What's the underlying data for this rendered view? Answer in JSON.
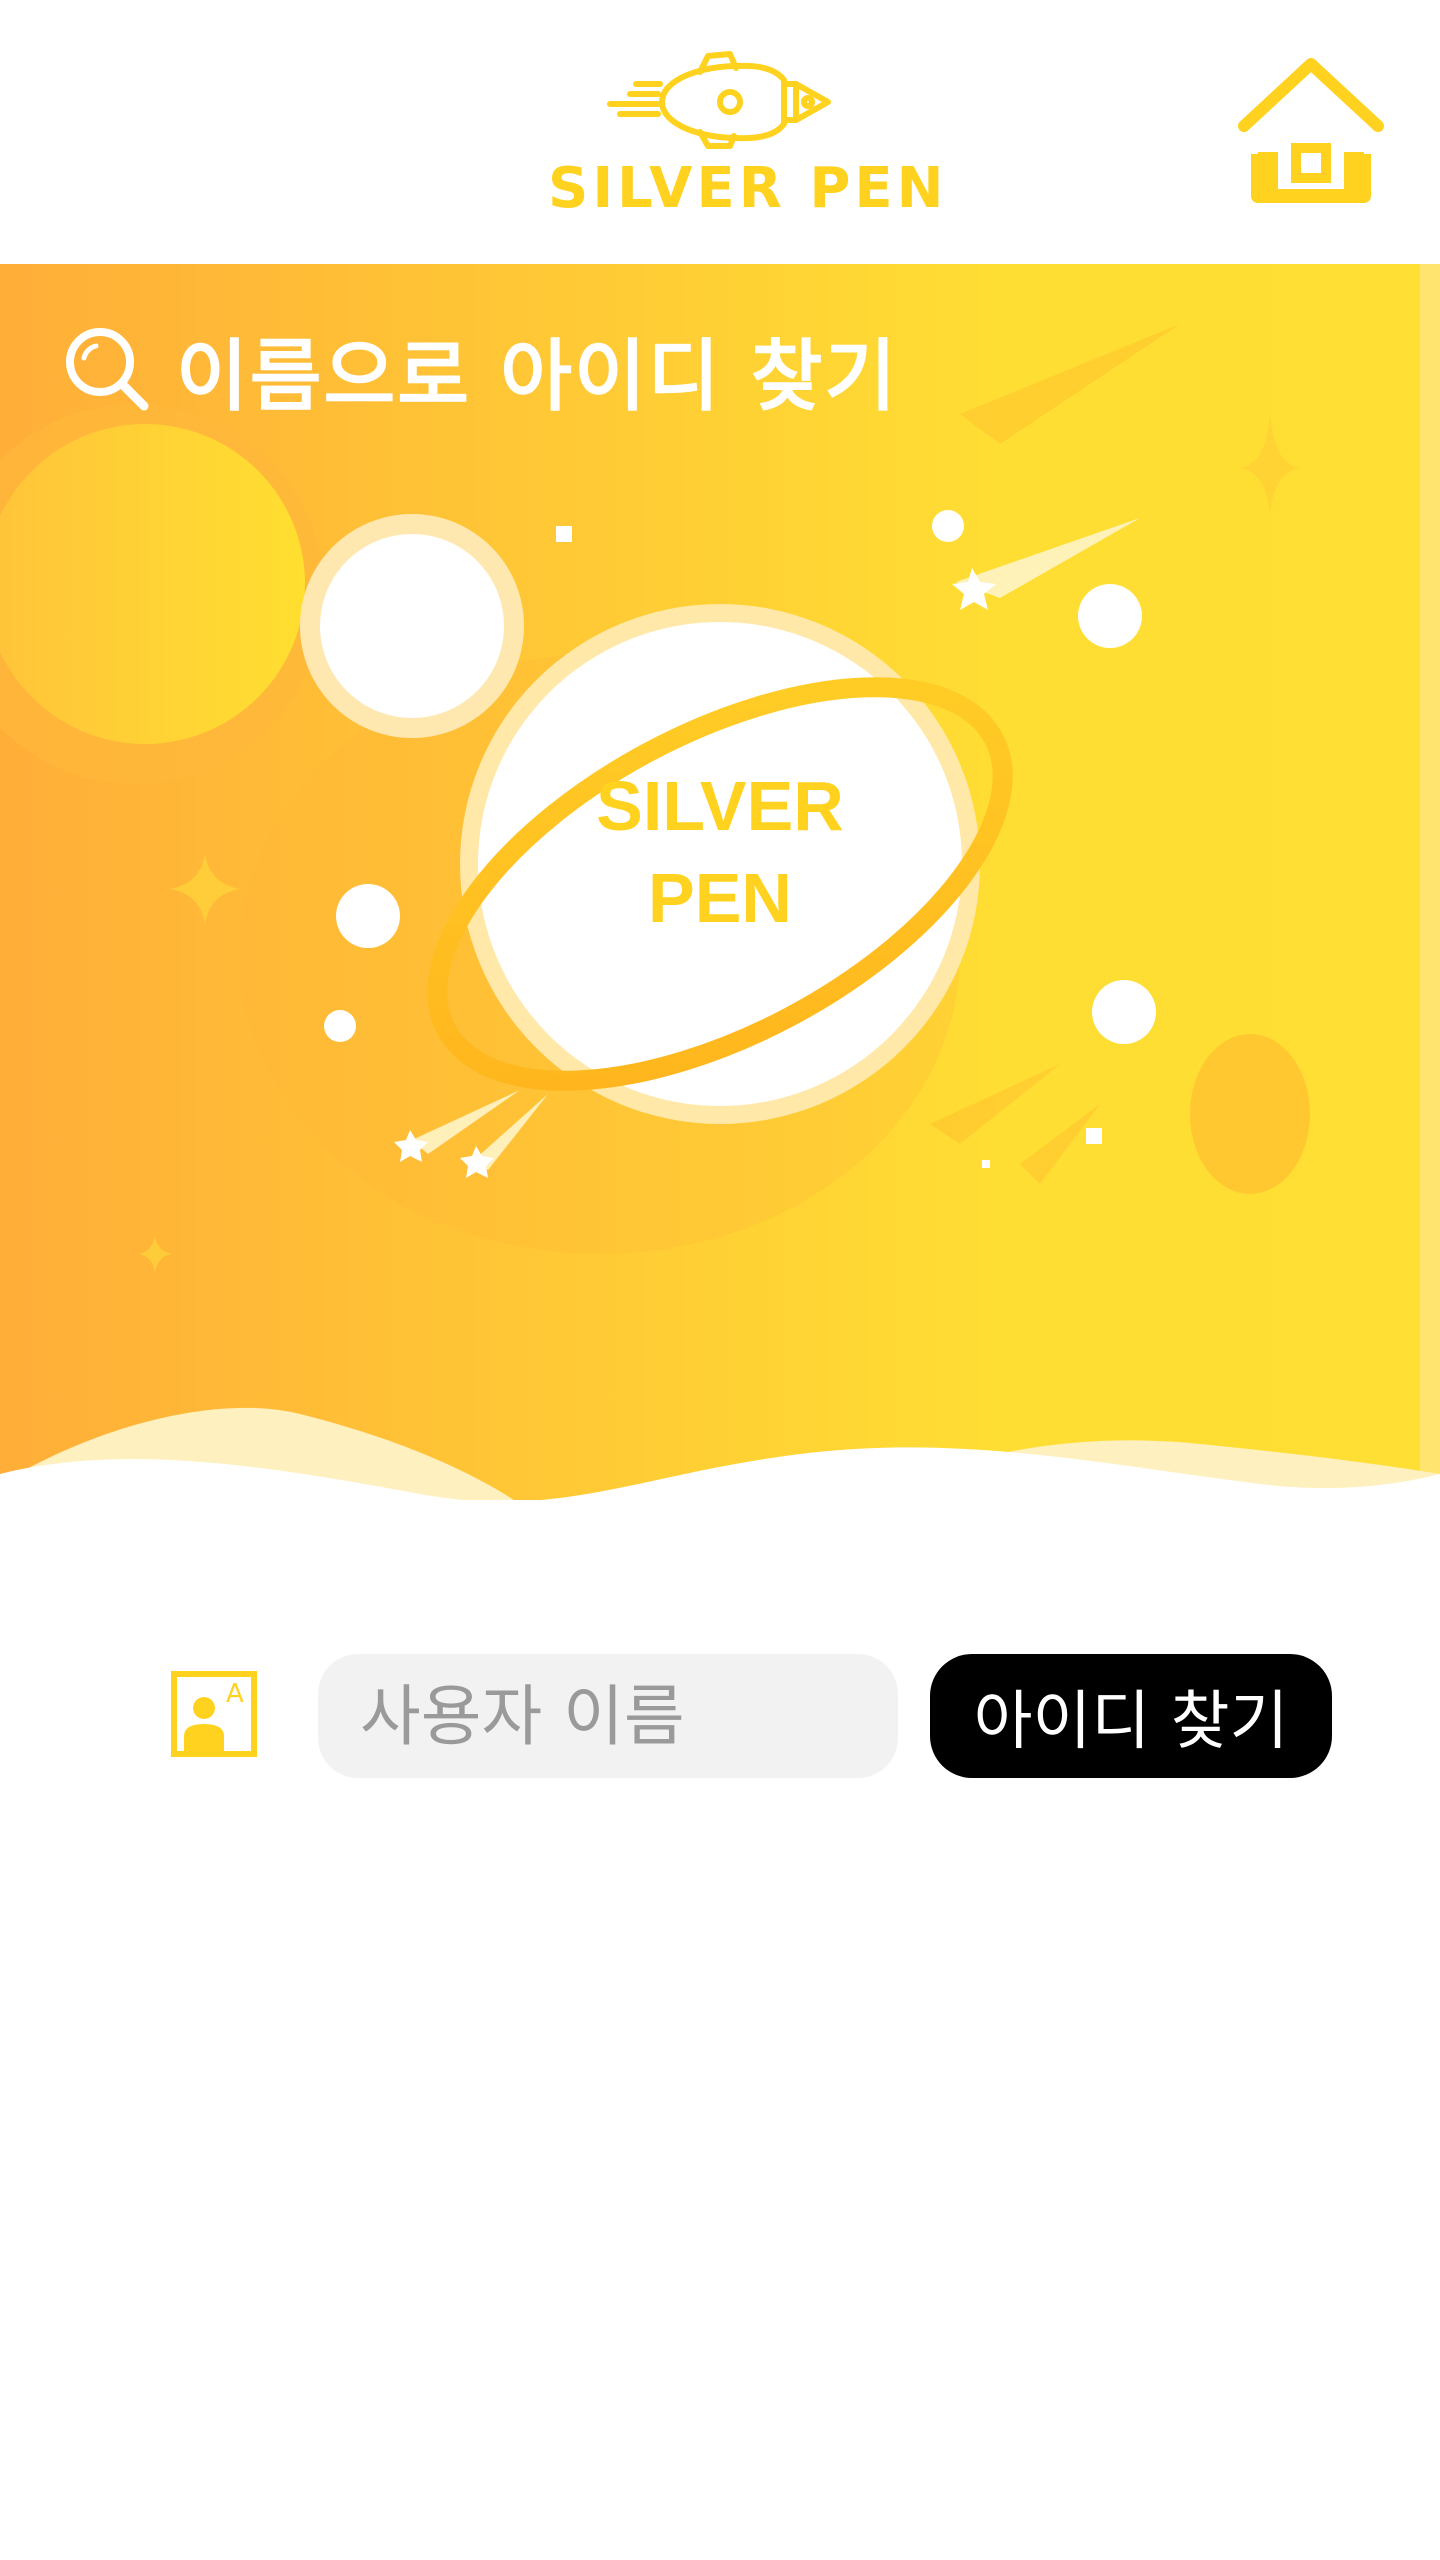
{
  "brand": {
    "name": "SILVER PEN",
    "color": "#FFD21F"
  },
  "header": {
    "home_icon": "home-icon"
  },
  "banner": {
    "title": "이름으로 아이디 찾기",
    "title_icon": "search-icon",
    "planet_line1": "SILVER",
    "planet_line2": "PEN",
    "gradient_start": "#FFAE38",
    "gradient_end": "#FFDE33"
  },
  "form": {
    "field_icon": "user-card-icon",
    "name_placeholder": "사용자 이름",
    "submit_label": "아이디 찾기"
  }
}
